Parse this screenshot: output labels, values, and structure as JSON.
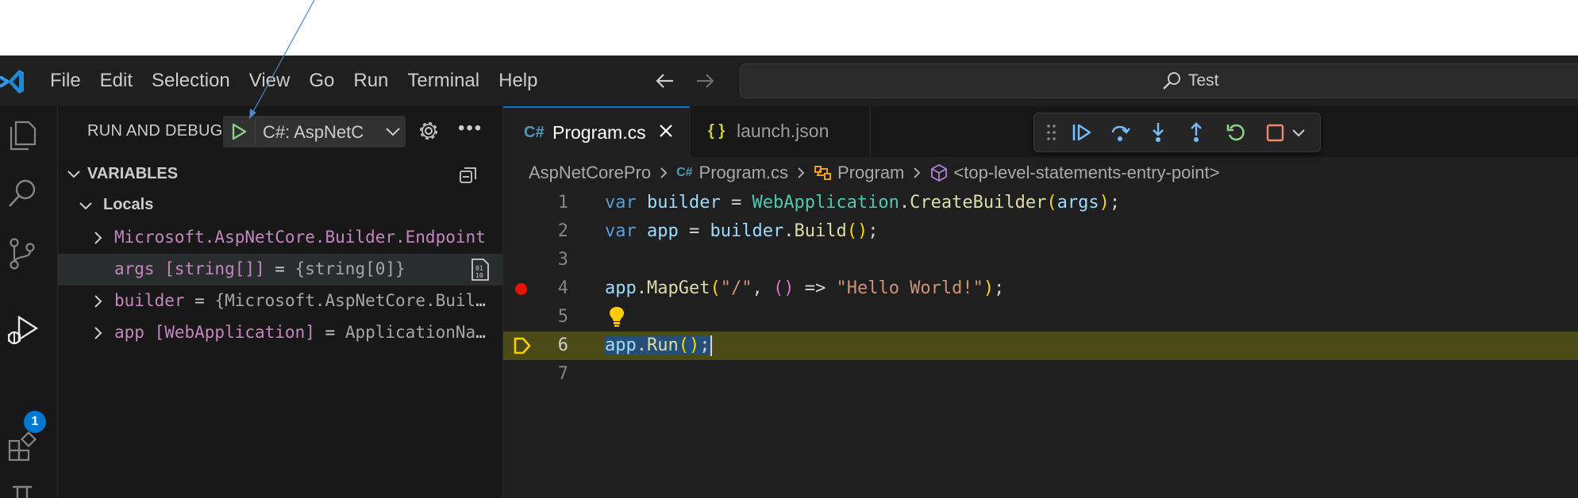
{
  "menu": {
    "items": [
      "File",
      "Edit",
      "Selection",
      "View",
      "Go",
      "Run",
      "Terminal",
      "Help"
    ]
  },
  "command_center": {
    "text": "Test"
  },
  "activity_bar": {
    "icons": [
      "explorer-icon",
      "search-icon",
      "source-control-icon",
      "run-debug-icon",
      "extensions-icon",
      "testing-icon"
    ],
    "debug_badge": "1"
  },
  "sidebar": {
    "title": "RUN AND DEBUG",
    "config_name": "C#: AspNetC",
    "variables_label": "VARIABLES",
    "locals_label": "Locals",
    "variables": [
      {
        "name": "Microsoft.AspNetCore.Builder.Endpoint",
        "eq": "",
        "value": "",
        "expandable": true
      },
      {
        "name": "args [string[]]",
        "eq": " = ",
        "value": "{string[0]}",
        "expandable": false
      },
      {
        "name": "builder",
        "eq": " = ",
        "value": "{Microsoft.AspNetCore.Builder.WebApplicationBuilder}",
        "expandable": true
      },
      {
        "name": "app [WebApplication]",
        "eq": " = ",
        "value": "ApplicationName = \"AspNetCoreProject\"",
        "expandable": true
      }
    ]
  },
  "editor": {
    "tabs": [
      {
        "label": "Program.cs",
        "icon": "C#",
        "active": true
      },
      {
        "label": "launch.json",
        "icon": "{ }",
        "active": false
      }
    ],
    "breadcrumb": [
      "AspNetCorePro",
      "Program.cs",
      "Program",
      "<top-level-statements-entry-point>"
    ],
    "line_numbers": [
      "1",
      "2",
      "3",
      "4",
      "5",
      "6",
      "7"
    ],
    "current_line": 6,
    "breakpoint_line": 4,
    "code": {
      "l1": {
        "kw": "var",
        "name": "builder",
        "eq": " = ",
        "type": "WebApplication",
        "dot": ".",
        "method": "CreateBuilder",
        "open": "(",
        "arg": "args",
        "close": ")",
        "end": ";"
      },
      "l2": {
        "kw": "var",
        "name": "app",
        "eq": " = ",
        "obj": "builder",
        "dot": ".",
        "method": "Build",
        "parens": "()",
        "end": ";"
      },
      "l4": {
        "obj": "app",
        "dot": ".",
        "method": "MapGet",
        "open": "(",
        "route": "\"/\"",
        "comma": ", ",
        "lambda": "()",
        "arrow": " => ",
        "message": "\"Hello World!\"",
        "close": ")",
        "end": ";"
      },
      "l6": {
        "obj": "app",
        "dot": ".",
        "method": "Run",
        "parens": "()",
        "end": ";"
      }
    }
  },
  "colors": {
    "accent": "#0078d4",
    "current_line": "#4b4b18",
    "breakpoint": "#e51400",
    "debug_continue": "#75beff",
    "debug_restart": "#89d185",
    "debug_stop": "#f48771"
  }
}
